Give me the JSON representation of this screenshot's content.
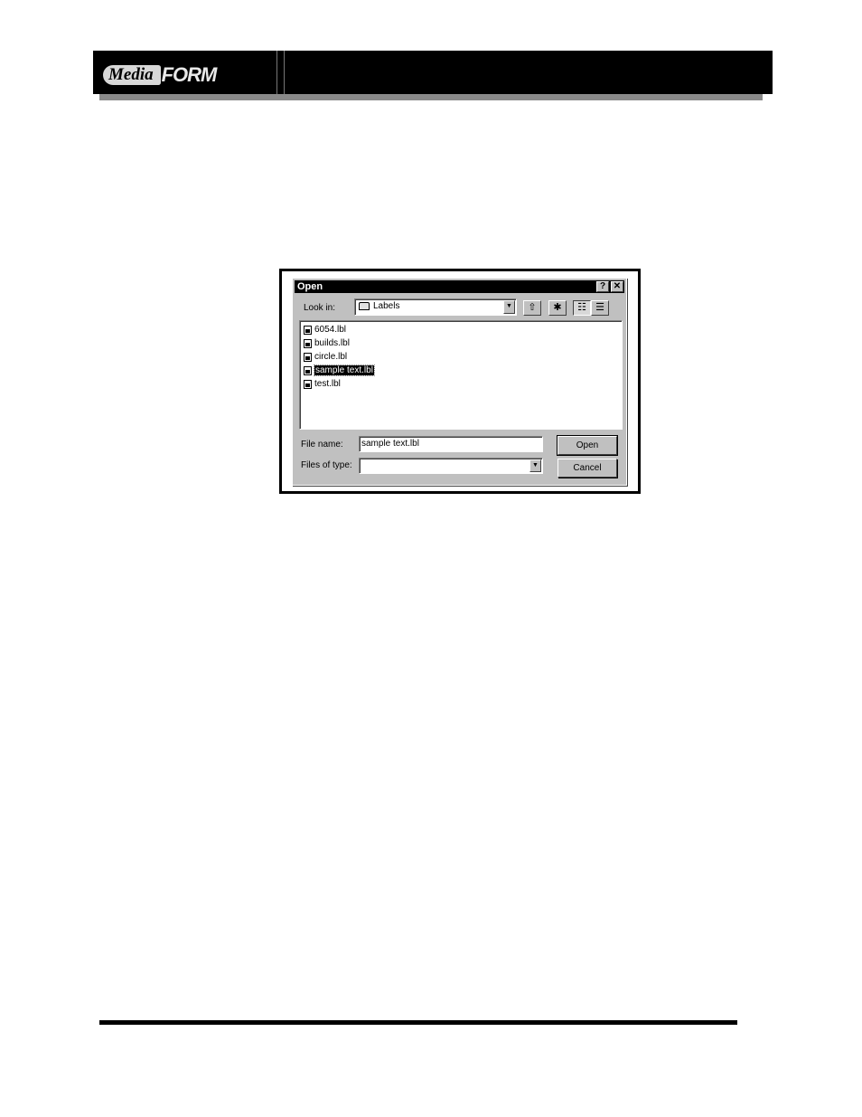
{
  "header": {
    "logo_part1": "Media",
    "logo_part2": "FORM"
  },
  "dialog": {
    "title": "Open",
    "help_button": "?",
    "close_button": "✕",
    "look_in_label": "Look in:",
    "look_in_value": "Labels",
    "files": [
      {
        "name": "6054.lbl",
        "selected": false
      },
      {
        "name": "builds.lbl",
        "selected": false
      },
      {
        "name": "circle.lbl",
        "selected": false
      },
      {
        "name": "sample text.lbl",
        "selected": true
      },
      {
        "name": "test.lbl",
        "selected": false
      }
    ],
    "file_name_label": "File name:",
    "file_name_value": "sample text.lbl",
    "files_of_type_label": "Files of type:",
    "files_of_type_value": "",
    "open_button": "Open",
    "cancel_button": "Cancel"
  },
  "colors": {
    "title_bar": "#000000",
    "dialog_face": "#c0c0c0",
    "banner": "#000000"
  },
  "icons": [
    "folder-icon",
    "up-one-level-icon",
    "new-folder-icon",
    "list-view-icon",
    "details-view-icon",
    "label-file-icon",
    "dropdown-arrow-icon"
  ]
}
